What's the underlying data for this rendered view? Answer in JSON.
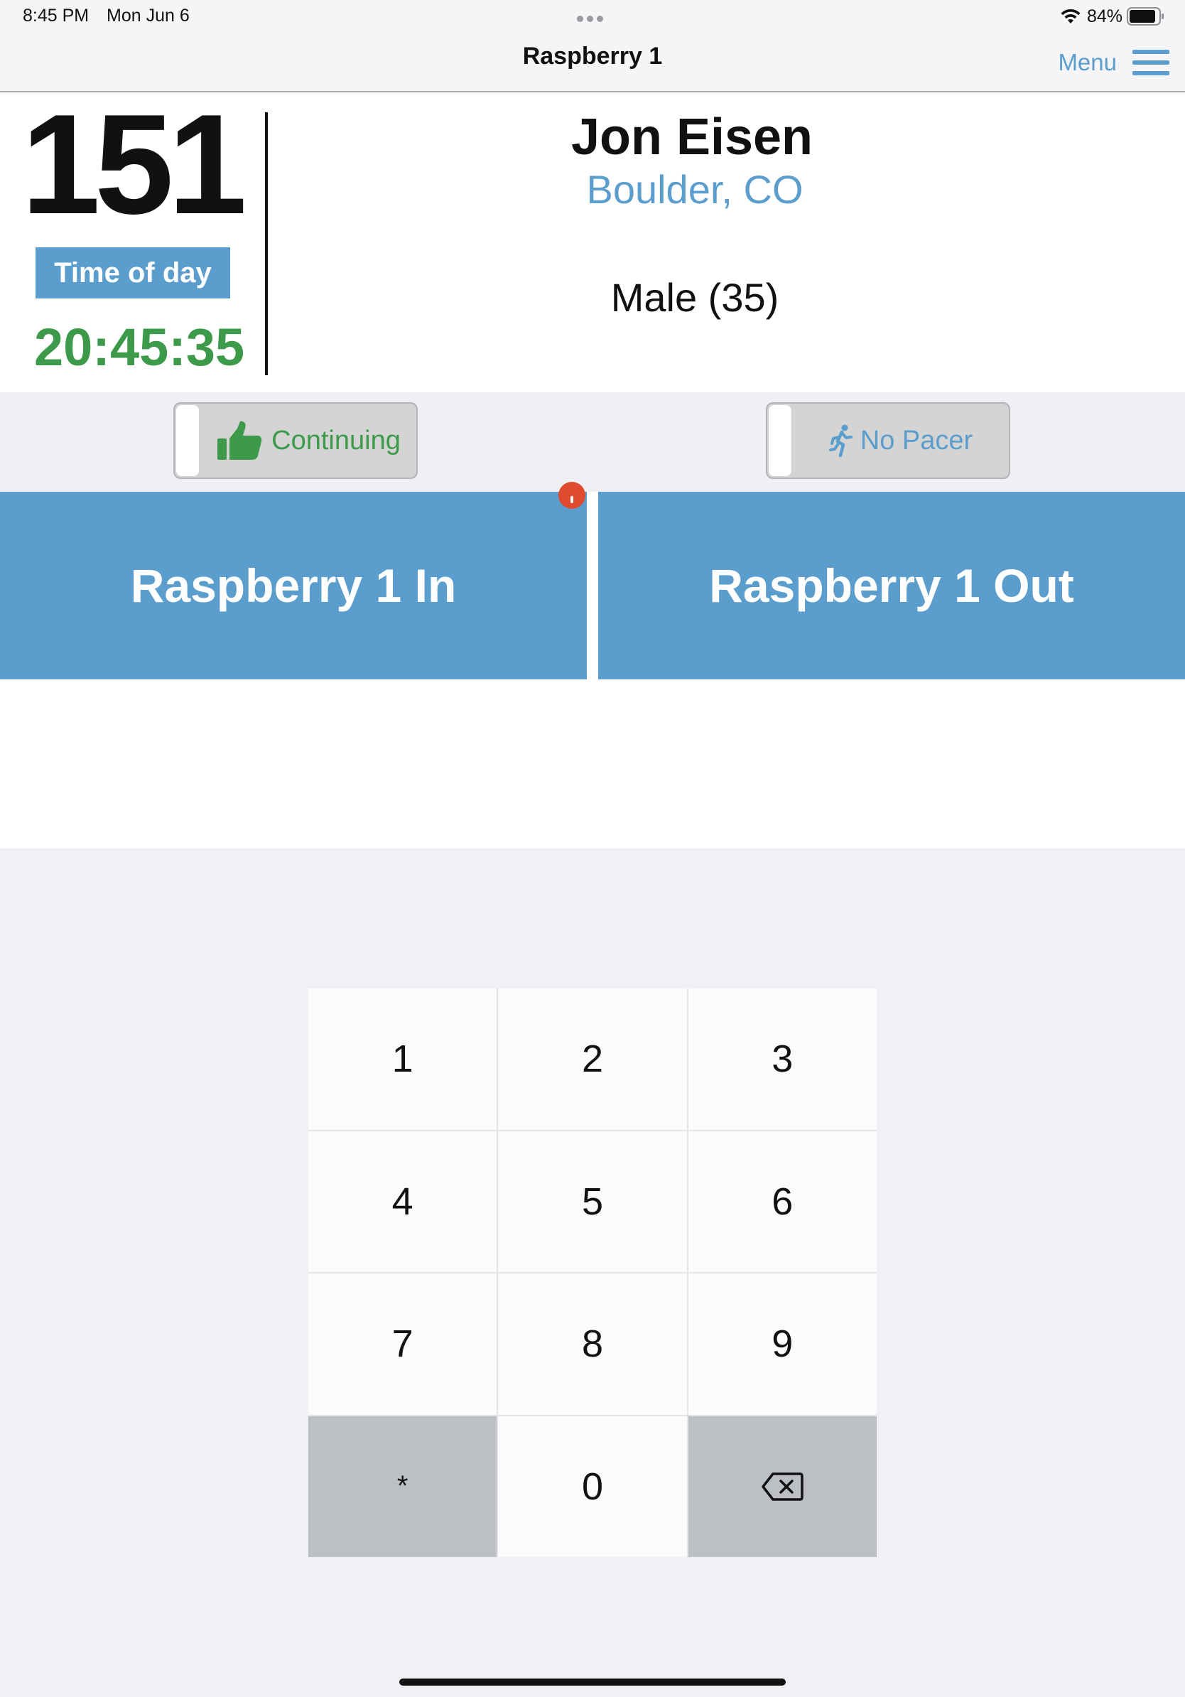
{
  "status_bar": {
    "time": "8:45 PM",
    "date": "Mon Jun 6",
    "battery": "84%",
    "icons": [
      "multitasking-dots-icon",
      "wifi-icon",
      "battery-icon"
    ]
  },
  "nav": {
    "title": "Raspberry 1",
    "menu_label": "Menu",
    "menu_icon": "hamburger-icon"
  },
  "runner": {
    "bib": "151",
    "time_label": "Time of day",
    "time_value": "20:45:35",
    "name": "Jon Eisen",
    "location": "Boulder, CO",
    "category": "Male (35)"
  },
  "toggles": {
    "continuing": {
      "label": "Continuing",
      "icon": "thumbs-up-icon",
      "on": false
    },
    "pacer": {
      "label": "No Pacer",
      "icon": "runner-icon",
      "on": false
    }
  },
  "actions": {
    "in_label": "Raspberry 1 In",
    "out_label": "Raspberry 1 Out"
  },
  "keypad": {
    "keys": [
      "1",
      "2",
      "3",
      "4",
      "5",
      "6",
      "7",
      "8",
      "9",
      "*",
      "0"
    ],
    "backspace_icon": "backspace-icon"
  },
  "colors": {
    "accent_blue": "#5b9dcc",
    "green": "#3d9a4a",
    "alert_red": "#e04a2f",
    "key_dark": "#bcbfc3"
  }
}
